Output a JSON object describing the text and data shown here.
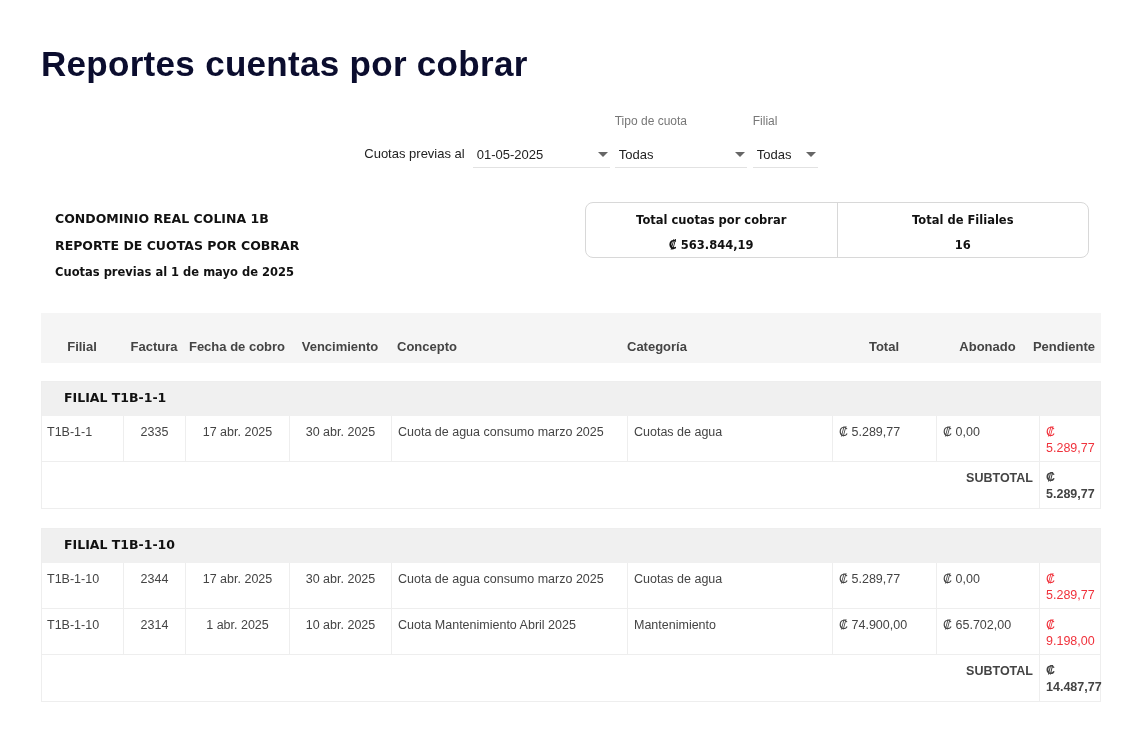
{
  "title": "Reportes cuentas por cobrar",
  "filters": {
    "date_label": "Cuotas previas al",
    "date_value": "01-05-2025",
    "fields": [
      {
        "label": "Tipo de cuota",
        "value": "Todas"
      },
      {
        "label": "Filial",
        "value": "Todas"
      }
    ]
  },
  "report_header": [
    "CONDOMINIO REAL COLINA 1B",
    "REPORTE DE CUOTAS POR COBRAR",
    "Cuotas previas al 1 de mayo de 2025"
  ],
  "summary": [
    {
      "label": "Total cuotas por cobrar",
      "value": "₡ 563.844,19"
    },
    {
      "label": "Total de Filiales",
      "value": "16"
    }
  ],
  "table": {
    "columns": [
      "Filial",
      "Factura",
      "Fecha de cobro",
      "Vencimiento",
      "Concepto",
      "Categoría",
      "Total",
      "Abonado",
      "Pendiente"
    ],
    "groups": [
      {
        "title": "FILIAL T1B-1-1",
        "rows": [
          [
            "T1B-1-1",
            "2335",
            "17 abr. 2025",
            "30 abr. 2025",
            "Cuota de agua consumo marzo 2025",
            "Cuotas de agua",
            "₡ 5.289,77",
            "₡ 0,00",
            "₡ 5.289,77"
          ]
        ],
        "subtotal_label": "SUBTOTAL",
        "subtotal": "₡ 5.289,77"
      },
      {
        "title": "FILIAL T1B-1-10",
        "rows": [
          [
            "T1B-1-10",
            "2344",
            "17 abr. 2025",
            "30 abr. 2025",
            "Cuota de agua consumo marzo 2025",
            "Cuotas de agua",
            "₡ 5.289,77",
            "₡ 0,00",
            "₡ 5.289,77"
          ],
          [
            "T1B-1-10",
            "2314",
            "1 abr. 2025",
            "10 abr. 2025",
            "Cuota Mantenimiento Abril 2025",
            "Mantenimiento",
            "₡ 74.900,00",
            "₡ 65.702,00",
            "₡ 9.198,00"
          ]
        ],
        "subtotal_label": "SUBTOTAL",
        "subtotal": "₡ 14.487,77"
      }
    ]
  }
}
